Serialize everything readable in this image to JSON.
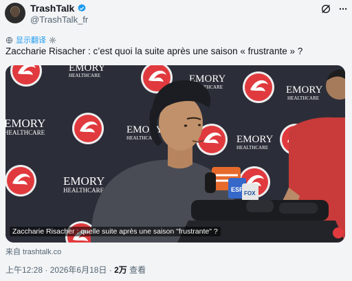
{
  "author": {
    "display_name": "TrashTalk",
    "handle": "@TrashTalk_fr",
    "verified": true
  },
  "translate": {
    "label": "显示翻译"
  },
  "tweet": {
    "text": "Zaccharie Risacher : c’est quoi la suite après une saison « frustrante » ?"
  },
  "media": {
    "caption": "Zaccharie Risacher : quelle suite après une saison \"frustrante\" ?",
    "sponsor_top": "EMORY",
    "sponsor_bottom": "HEALTHCARE",
    "mic_label": "ESPN",
    "mic_label_2": "FOX"
  },
  "source": {
    "text": "来自 trashtalk.co"
  },
  "meta": {
    "time": "上午12:28",
    "date": "2026年6月18日",
    "views_count": "2万",
    "views_label": "查看",
    "separator": "·"
  },
  "colors": {
    "accent": "#1d9bf0",
    "hawks_red": "#e03a3e",
    "text_secondary": "#536471"
  }
}
